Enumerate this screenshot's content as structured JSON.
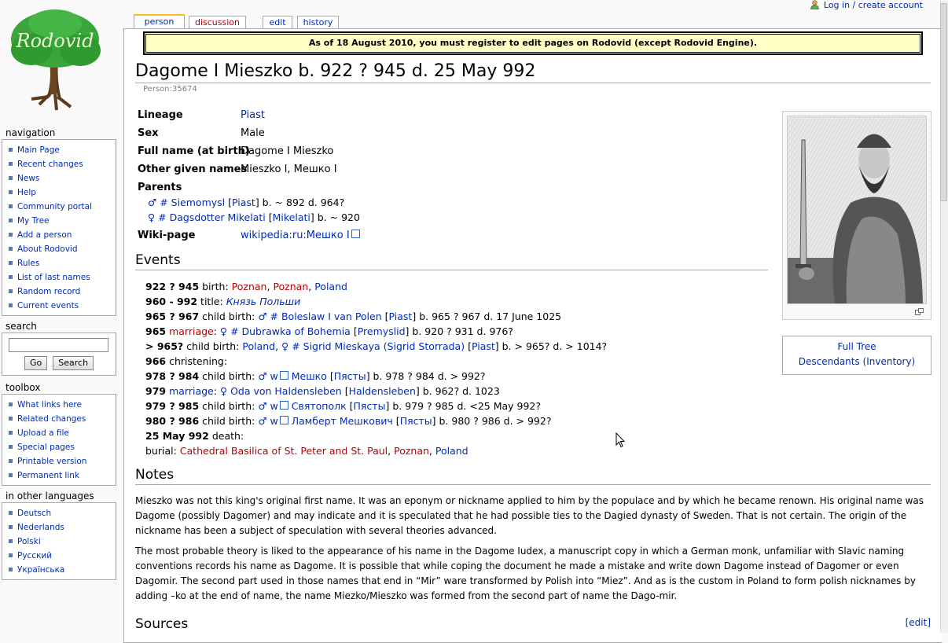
{
  "logo": {
    "text": "Rodovid"
  },
  "personal": {
    "login": "Log in / create account"
  },
  "tabs": [
    {
      "label": "person"
    },
    {
      "label": "discussion"
    },
    {
      "label": "edit"
    },
    {
      "label": "history"
    }
  ],
  "sitenotice": "As of 18 August 2010, you must register to edit pages on Rodovid (except Rodovid Engine).",
  "title": "Dagome I Mieszko b. 922 ? 945 d. 25 May 992",
  "person_id": "Person:35674",
  "navigation": {
    "heading": "navigation",
    "items": [
      "Main Page",
      "Recent changes",
      "News",
      "Help",
      "Community portal",
      "My Tree",
      "Add a person",
      "About Rodovid",
      "Rules",
      "List of last names",
      "Random record",
      "Current events"
    ]
  },
  "search": {
    "heading": "search",
    "go": "Go",
    "search": "Search"
  },
  "toolbox": {
    "heading": "toolbox",
    "items": [
      "What links here",
      "Related changes",
      "Upload a file",
      "Special pages",
      "Printable version",
      "Permanent link"
    ]
  },
  "languages": {
    "heading": "in other languages",
    "items": [
      "Deutsch",
      "Nederlands",
      "Polski",
      "Русский",
      "Українська"
    ]
  },
  "info": {
    "lineage_label": "Lineage",
    "lineage": "Piast",
    "sex_label": "Sex",
    "sex": "Male",
    "fullname_label": "Full name (at birth)",
    "fullname": "Dagome I Mieszko",
    "given_label": "Other given names",
    "given": "Mieszko I, Мешко I",
    "parents_label": "Parents",
    "father": {
      "sym": "♂",
      "name": "# Siemomysl",
      "lineage": "Piast",
      "dates": "b. ~ 892 d. 964?"
    },
    "mother": {
      "sym": "♀",
      "name": "# Dagsdotter Mikelati",
      "lineage": "Mikelati",
      "dates": "b. ~ 920"
    },
    "wiki_label": "Wiki-page",
    "wiki": "wikipedia:ru:Мешко I"
  },
  "events": {
    "heading": "Events",
    "e1": {
      "date": "922 ? 945",
      "type": " birth: ",
      "p1": "Poznan",
      "p2": "Poznan",
      "p3": "Poland"
    },
    "e2": {
      "date": "960 - 992",
      "type": " title: ",
      "title": "Князь Польши"
    },
    "e3": {
      "date": "965 ? 967",
      "type": " child birth: ",
      "sym": "♂",
      "name": "# Boleslaw I van Polen",
      "lin": "Piast",
      "dates": "b. 965 ? 967 d. 17 June 1025"
    },
    "e4": {
      "date": "965",
      "type": "marriage",
      "sym": "♀",
      "name": "# Dubrawka of Bohemia",
      "lin": "Premyslid",
      "dates": "b. 920 ? 931 d. 976?"
    },
    "e5": {
      "date": "> 965?",
      "type": " child birth: ",
      "place": "Poland",
      "sym": "♀",
      "name": "# Sigrid Mieskaya (Sigrid Storrada)",
      "lin": "Piast",
      "dates": "b. > 965? d. > 1014?"
    },
    "e6": {
      "date": "966",
      "type": " christening:"
    },
    "e7": {
      "date": "978 ? 984",
      "type": " child birth: ",
      "sym": "♂",
      "w": "w",
      "name": "Мешко",
      "lin": "Пясты",
      "dates": "b. 978 ? 984 d. > 992?"
    },
    "e8": {
      "date": "979",
      "type": "marriage",
      "sym": "♀",
      "name": "Oda von Haldensleben",
      "lin": "Haldensleben",
      "dates": "b. 962? d. 1023"
    },
    "e9": {
      "date": "979 ? 985",
      "type": " child birth: ",
      "sym": "♂",
      "w": "w",
      "name": "Святополк",
      "lin": "Пясты",
      "dates": "b. 979 ? 985 d. <25 May 992?"
    },
    "e10": {
      "date": "980 ? 986",
      "type": " child birth: ",
      "sym": "♂",
      "w": "w",
      "name": "Ламберт Мешкович",
      "lin": "Пясты",
      "dates": "b. 980 ? 986 d. > 992?"
    },
    "e11": {
      "date": "25 May 992",
      "type": " death:"
    },
    "e12": {
      "type": "burial: ",
      "place": "Cathedral Basilica of St. Peter and St. Paul",
      "p2": "Poznan",
      "p3": "Poland"
    }
  },
  "notes": {
    "heading": "Notes",
    "p1": "Mieszko was not this king's original first name. It was an eponym or nickname applied to him by the populace and by which he became renown. His original name was Dagome (possibly Dagomer) and may indicate and it is speculated that he had possible ties to the Dagied dynasty of Sweden. That is not certain. The origin of the nickname has been a subject of speculation with several theories advanced.",
    "p2": "The most probable theory is liked to the appearance of his name in the Dagome Iudex, a manuscript copy in which a German monk, unfamiliar with Slavic naming conventions records his name as Dagome. It is possible that while coping the document he made a mistake and write down Dagome instead of Dagomer or even Dagomir. The second part used in those names that end in “Mir” ware transformed by Polish into “Miez”. And as is the custom in Poland to form polish nicknames by adding –ko at the end of name, the name Miezko/Mieszko was formed from the second part of name the Dago-mir."
  },
  "sources": {
    "heading": "Sources",
    "edit": "[edit]"
  },
  "sidebox": {
    "full_tree": "Full Tree",
    "descendants": "Descendants (Inventory)"
  },
  "colors": {
    "link": "#002bb8",
    "new_link": "#ba0000",
    "notice_bg": "#ffffc6",
    "tab_accent": "#fabd23"
  }
}
